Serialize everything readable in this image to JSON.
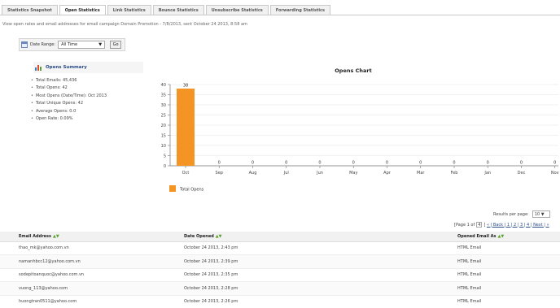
{
  "tabs": [
    {
      "label": "Statistics Snapshot",
      "active": false
    },
    {
      "label": "Open Statistics",
      "active": true
    },
    {
      "label": "Link Statistics",
      "active": false
    },
    {
      "label": "Bounce Statistics",
      "active": false
    },
    {
      "label": "Unsubscribe Statistics",
      "active": false
    },
    {
      "label": "Forwarding Statistics",
      "active": false
    }
  ],
  "description": "View open rates and email addresses for email campaign Domain Promotion - 7/8/2013, sent October 24 2013, 8:58 am",
  "date_range": {
    "label": "Date Range:",
    "value": "All Time",
    "go_label": "Go"
  },
  "summary": {
    "title": "Opens Summary",
    "items": [
      "Total Emails: 45,436",
      "Total Opens: 42",
      "Most Opens (Date/Time): Oct 2013",
      "Total Unique Opens: 42",
      "Average Opens: 0.0",
      "Open Rate: 0.09%"
    ]
  },
  "chart_data": {
    "type": "bar",
    "title": "Opens Chart",
    "categories": [
      "Oct",
      "Sep",
      "Aug",
      "Jul",
      "Jun",
      "May",
      "Apr",
      "Mar",
      "Feb",
      "Jan",
      "Dec",
      "Nov"
    ],
    "series": [
      {
        "name": "Total Opens",
        "values": [
          38,
          0,
          0,
          0,
          0,
          0,
          0,
          0,
          0,
          0,
          0,
          0
        ]
      }
    ],
    "ylim": [
      0,
      40
    ],
    "yticks": [
      0,
      5,
      10,
      15,
      20,
      25,
      30,
      35,
      40
    ],
    "grid": true,
    "legend": "bottom-left",
    "color": "#f39425"
  },
  "pagination": {
    "results_label": "Results per page:",
    "results_value": "10",
    "page_prefix": "[Page 1 of",
    "page_value": "4",
    "page_suffix": "]",
    "links_text": "« | Back | 1 | 2 | 3 | 4 | Next | »"
  },
  "table": {
    "columns": [
      "Email Address",
      "Date Opened",
      "Opened Email As"
    ],
    "rows": [
      [
        "thao_mk@yahoo.com.vn",
        "October 24 2013, 2:43 pm",
        "HTML Email"
      ],
      [
        "namanhbcc12@yahoo.com.vn",
        "October 24 2013, 2:39 pm",
        "HTML Email"
      ],
      [
        "sodepitoanquoc@yahoo.com.vn",
        "October 24 2013, 2:35 pm",
        "HTML Email"
      ],
      [
        "vuong_113@yahoo.com",
        "October 24 2013, 2:28 pm",
        "HTML Email"
      ],
      [
        "huongtran0511@yahoo.com",
        "October 24 2013, 2:26 pm",
        "HTML Email"
      ]
    ]
  }
}
